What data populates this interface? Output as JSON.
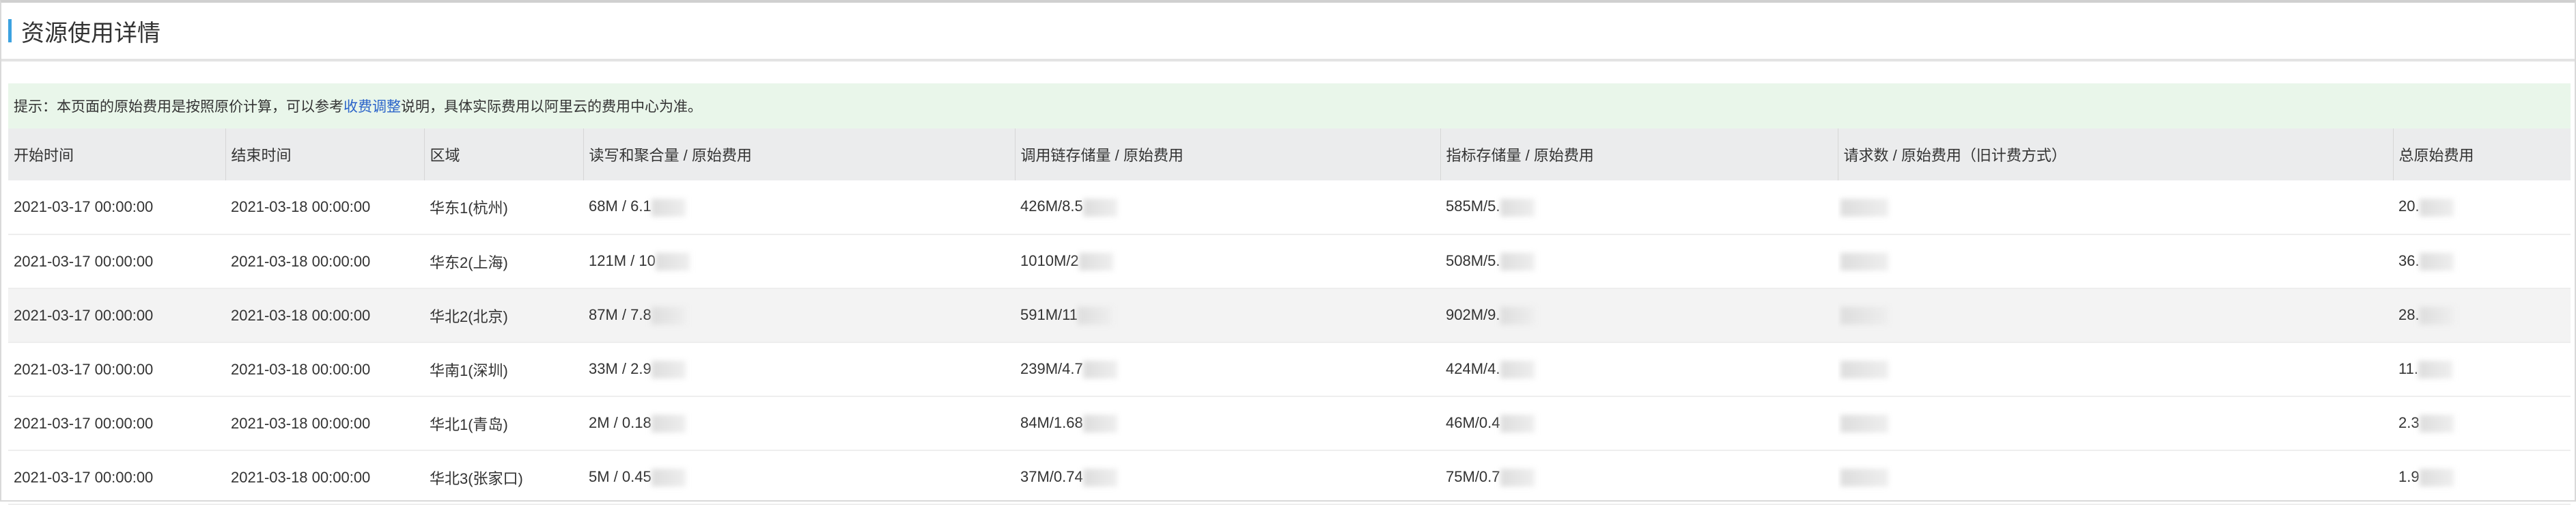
{
  "title": "资源使用详情",
  "notice": {
    "prefix": "提示：本页面的原始费用是按照原价计算，可以参考",
    "link": "收费调整",
    "suffix": "说明，具体实际费用以阿里云的费用中心为准。"
  },
  "columns": [
    "开始时间",
    "结束时间",
    "区域",
    "读写和聚合量 / 原始费用",
    "调用链存储量 / 原始费用",
    "指标存储量 / 原始费用",
    "请求数 / 原始费用（旧计费方式）",
    "总原始费用"
  ],
  "rows": [
    {
      "start": "2021-03-17 00:00:00",
      "end": "2021-03-18 00:00:00",
      "region": "华东1(杭州)",
      "rw": "68M / 6.1",
      "trace": "426M/8.5",
      "metric": "585M/5.",
      "total": "20."
    },
    {
      "start": "2021-03-17 00:00:00",
      "end": "2021-03-18 00:00:00",
      "region": "华东2(上海)",
      "rw": "121M / 10",
      "trace": "1010M/2",
      "metric": "508M/5.",
      "total": "36."
    },
    {
      "start": "2021-03-17 00:00:00",
      "end": "2021-03-18 00:00:00",
      "region": "华北2(北京)",
      "rw": "87M / 7.8",
      "trace": "591M/11",
      "metric": "902M/9.",
      "total": "28."
    },
    {
      "start": "2021-03-17 00:00:00",
      "end": "2021-03-18 00:00:00",
      "region": "华南1(深圳)",
      "rw": "33M / 2.9",
      "trace": "239M/4.7",
      "metric": "424M/4.",
      "total": "11."
    },
    {
      "start": "2021-03-17 00:00:00",
      "end": "2021-03-18 00:00:00",
      "region": "华北1(青岛)",
      "rw": "2M / 0.18",
      "trace": "84M/1.68",
      "metric": "46M/0.4",
      "total": "2.3"
    },
    {
      "start": "2021-03-17 00:00:00",
      "end": "2021-03-18 00:00:00",
      "region": "华北3(张家口)",
      "rw": "5M / 0.45",
      "trace": "37M/0.74",
      "metric": "75M/0.7",
      "total": "1.9"
    }
  ]
}
